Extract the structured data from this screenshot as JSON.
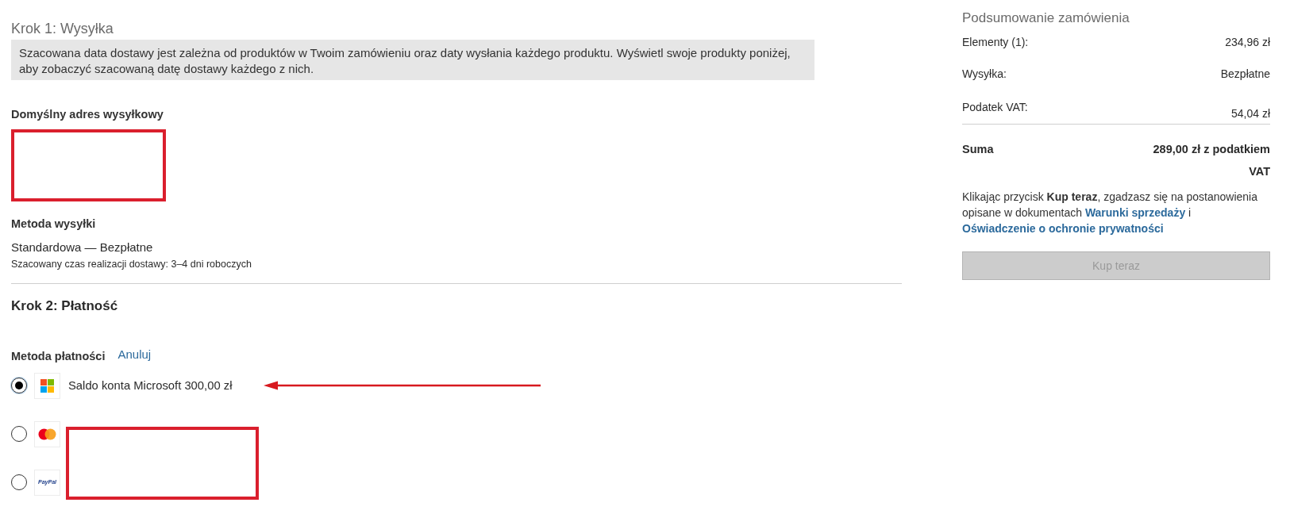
{
  "shipping": {
    "step_title": "Krok 1: Wysyłka",
    "notice": "Szacowana data dostawy jest zależna od produktów w Twoim zamówieniu oraz daty wysłania każdego produktu. Wyświetl swoje produkty poniżej, aby zobaczyć szacowaną datę dostawy każdego z nich.",
    "address_heading": "Domyślny adres wysyłkowy",
    "method_heading": "Metoda wysyłki",
    "method": "Standardowa — Bezpłatne",
    "delivery_estimate": "Szacowany czas realizacji dostawy: 3–4 dni roboczych"
  },
  "payment": {
    "step_title": "Krok 2: Płatność",
    "method_heading": "Metoda płatności",
    "cancel_link": "Anuluj",
    "methods": [
      {
        "kind": "microsoft",
        "label": "Saldo konta Microsoft 300,00 zł",
        "selected": true,
        "highlighted": true
      },
      {
        "kind": "mastercard",
        "selected": false,
        "highlighted": false
      },
      {
        "kind": "paypal",
        "logo_text": "PayPal",
        "selected": false,
        "highlighted": false
      }
    ]
  },
  "summary": {
    "title": "Podsumowanie zamówienia",
    "rows": [
      {
        "label": "Elementy (1):",
        "value": "234,96 zł"
      },
      {
        "label": "Wysyłka:",
        "value": "Bezpłatne"
      },
      {
        "label": "Podatek VAT:",
        "value": "54,04 zł"
      }
    ],
    "total": {
      "label": "Suma",
      "value": "289,00 zł z podatkiem VAT"
    },
    "terms": {
      "text": "Klikając przycisk **Kup teraz**, zgadzasz się na postanowienia opisane w dokumentach",
      "links": [
        "Warunki sprzedaży",
        "Oświadczenie o ochronie prywatności"
      ],
      "joiner": "i"
    },
    "buy_button": {
      "label": "Kup teraz",
      "disabled": true
    }
  }
}
